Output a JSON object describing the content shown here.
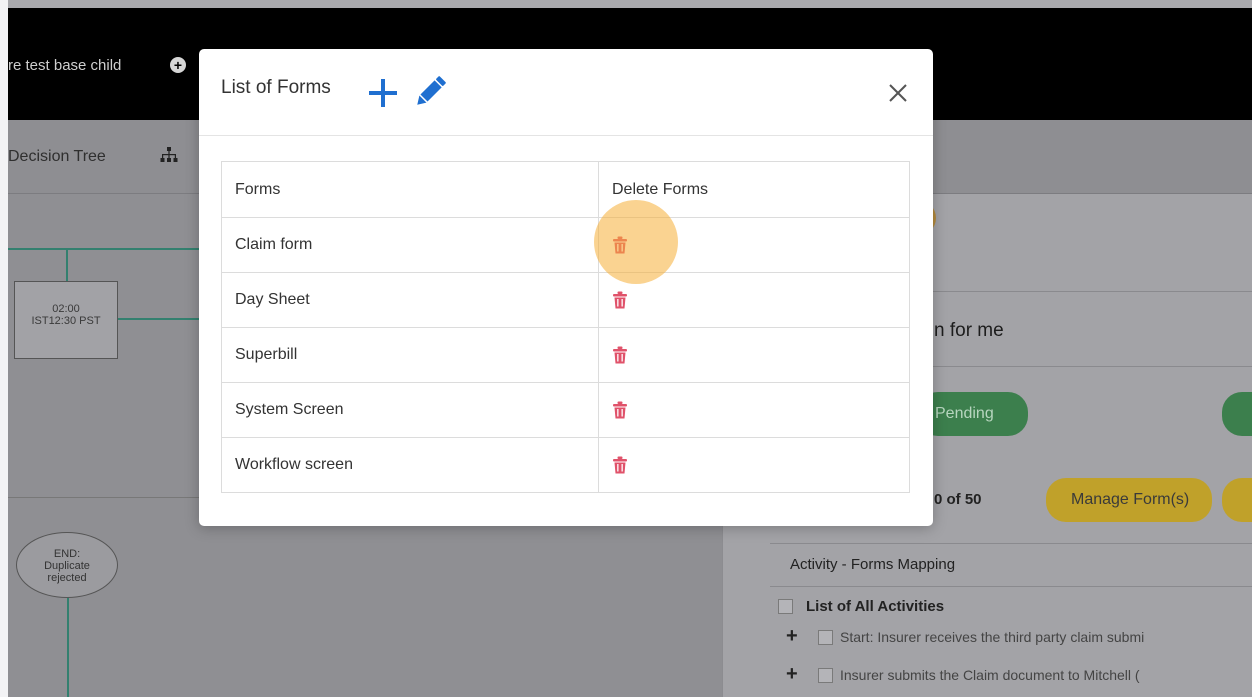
{
  "header": {
    "breadcrumb": "re test base child"
  },
  "tabs": {
    "decision_tree": "Decision Tree"
  },
  "diagram": {
    "node_time_line1": "02:00",
    "node_time_line2": "IST12:30 PST",
    "end_node_line1": "END:",
    "end_node_line2": "Duplicate",
    "end_node_line3": "rejected"
  },
  "right_panel": {
    "title_fragment": "n for me",
    "pending_label": "Pending",
    "count_text": "0 of 50",
    "manage_forms_label": "Manage Form(s)",
    "mapping_header": "Activity - Forms Mapping",
    "all_activities": "List of All Activities",
    "activities": [
      "Start: Insurer receives the third party claim submi",
      "Insurer submits the Claim document to Mitchell ("
    ],
    "colors": {
      "green": "#3c7f4d",
      "yellow": "#c0a12a"
    }
  },
  "modal": {
    "title": "List of Forms",
    "columns": [
      "Forms",
      "Delete Forms"
    ],
    "forms": [
      "Claim form",
      "Day Sheet",
      "Superbill",
      "System Screen",
      "Workflow screen"
    ],
    "icons": {
      "add": "plus-icon",
      "edit": "pencil-icon",
      "close": "close-icon",
      "delete": "trash-icon"
    },
    "colors": {
      "accent": "#1f6fd0",
      "delete": "#e0526a",
      "highlight": "#f5af37"
    }
  }
}
